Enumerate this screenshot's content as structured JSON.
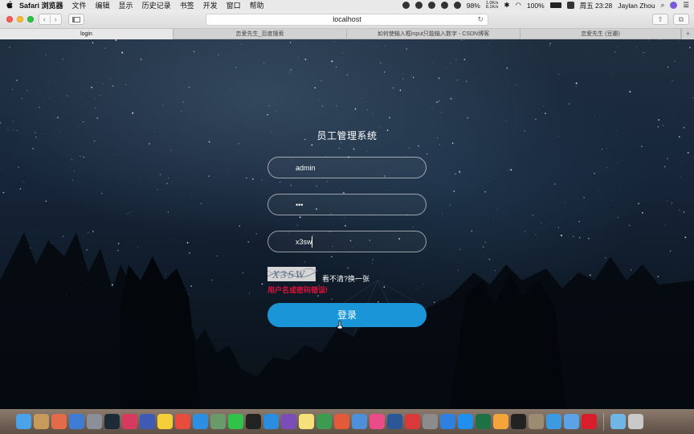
{
  "menubar": {
    "app_name": "Safari 浏览器",
    "menus": [
      "文件",
      "编辑",
      "显示",
      "历史记录",
      "书签",
      "开发",
      "窗口",
      "帮助"
    ],
    "net_up": "1.0K/s",
    "net_down": "8.1K/s",
    "cpu": "98%",
    "battery": "100%",
    "clock": "周五 23:28",
    "user": "Jaylan Zhou"
  },
  "toolbar": {
    "url": "localhost",
    "back_icon": "chevron-left-icon",
    "forward_icon": "chevron-right-icon",
    "sidebar_icon": "sidebar-icon",
    "reload_icon": "reload-icon",
    "share_icon": "share-icon",
    "tabs_icon": "tabs-icon"
  },
  "tabs": [
    {
      "label": "login",
      "active": true
    },
    {
      "label": "恋爱先生_百度搜索",
      "active": false
    },
    {
      "label": "如何使输入框input只能输入数字 - CSDN博客",
      "active": false
    },
    {
      "label": "恋爱先生 (豆瓣)",
      "active": false
    }
  ],
  "login": {
    "title": "员工管理系统",
    "username_value": "admin",
    "password_value": "•••",
    "captcha_input_value": "x3sw",
    "captcha_image_text": "X3SW",
    "captcha_refresh_text": "看不清?换一张",
    "captcha_error_text": "用户名或密码错误!",
    "submit_label": "登录"
  },
  "colors": {
    "button": "#1a96d8",
    "error": "#e0103a"
  },
  "dock": {
    "apps": [
      "finder",
      "notes",
      "photos",
      "preview",
      "launchpad",
      "pycharm",
      "intellij",
      "terminal",
      "stickies",
      "chrome",
      "safari",
      "screenshot",
      "wechat",
      "qq",
      "app-store",
      "axure",
      "notes-pad",
      "numbers",
      "calendar",
      "preview2",
      "itunes",
      "word",
      "paste",
      "system-preferences",
      "baidu-netdisk",
      "teamviewer",
      "excel",
      "sketch",
      "qq2",
      "trash-tool",
      "xcode",
      "mail",
      "netease-music",
      "folder",
      "trash"
    ]
  }
}
